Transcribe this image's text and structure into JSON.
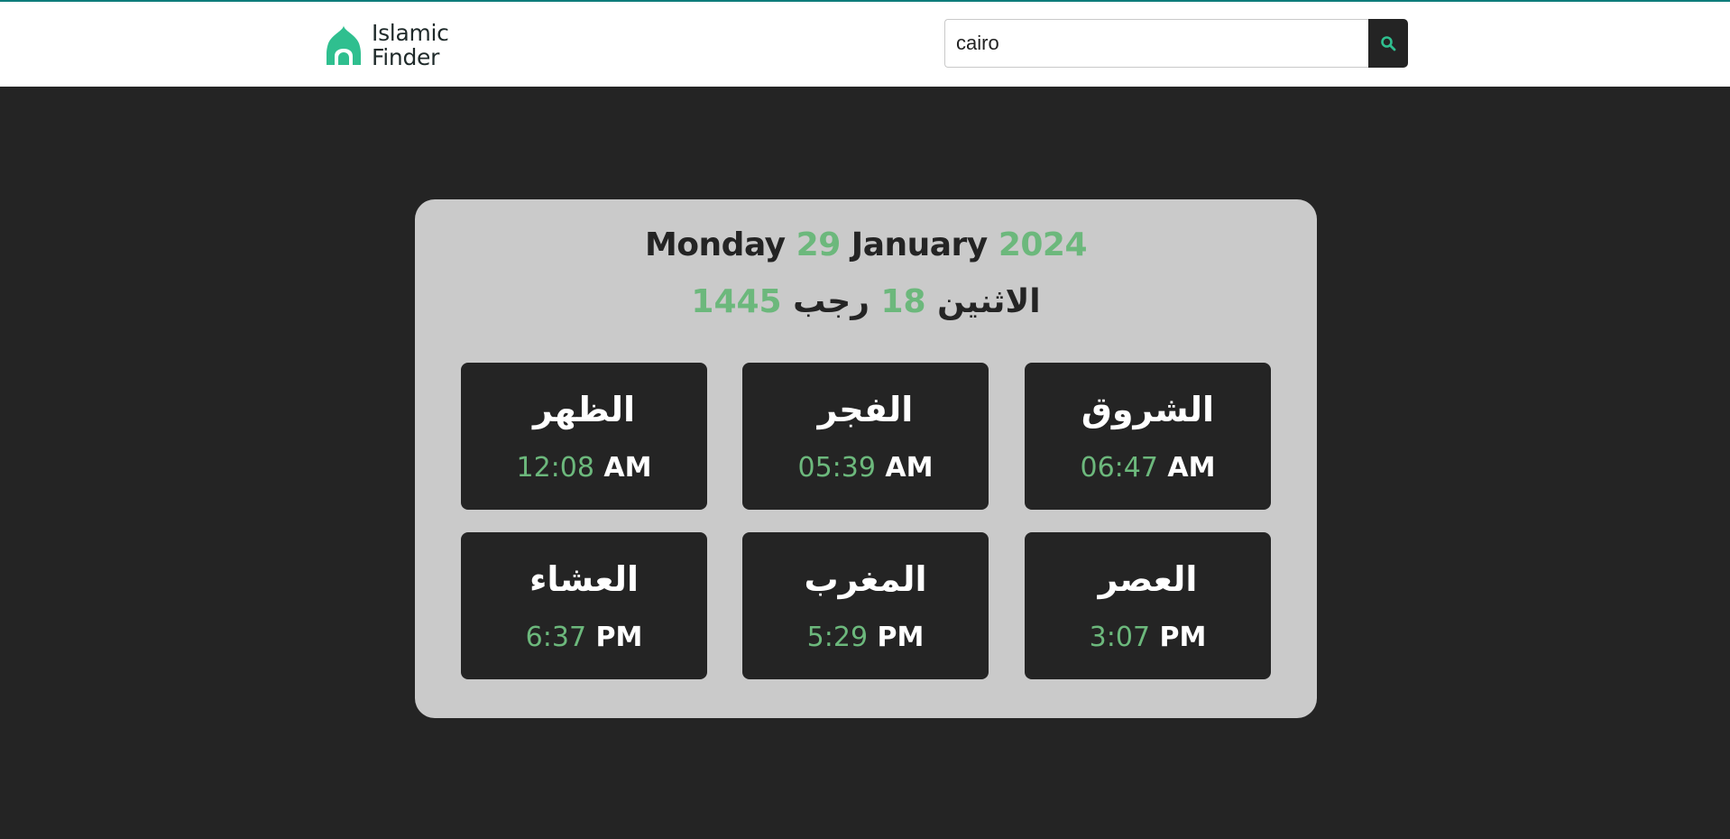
{
  "header": {
    "logo_line1": "Islamic",
    "logo_line2": "Finder",
    "search": {
      "value": "cairo",
      "placeholder": ""
    },
    "search_icon": "search-icon",
    "colors": {
      "accent": "#2fbf8f",
      "topline": "#0e7c7b",
      "search_button_bg": "#242424"
    }
  },
  "card": {
    "gregorian": {
      "weekday": "Monday",
      "day": "29",
      "month": "January",
      "year": "2024"
    },
    "hijri": {
      "weekday": "الاثنين",
      "day": "18",
      "month": "رجب",
      "year": "1445"
    },
    "prayers": [
      {
        "name": "الشروق",
        "time": "06:47",
        "period": "AM"
      },
      {
        "name": "الفجر",
        "time": "05:39",
        "period": "AM"
      },
      {
        "name": "الظهر",
        "time": "12:08",
        "period": "AM"
      },
      {
        "name": "العصر",
        "time": "3:07",
        "period": "PM"
      },
      {
        "name": "المغرب",
        "time": "5:29",
        "period": "PM"
      },
      {
        "name": "العشاء",
        "time": "6:37",
        "period": "PM"
      }
    ]
  },
  "colors": {
    "page_bg": "#242424",
    "card_bg": "#cacaca",
    "tile_bg": "#242424",
    "highlight": "#6cb87c",
    "text_dark": "#242424",
    "text_light": "#ffffff"
  }
}
